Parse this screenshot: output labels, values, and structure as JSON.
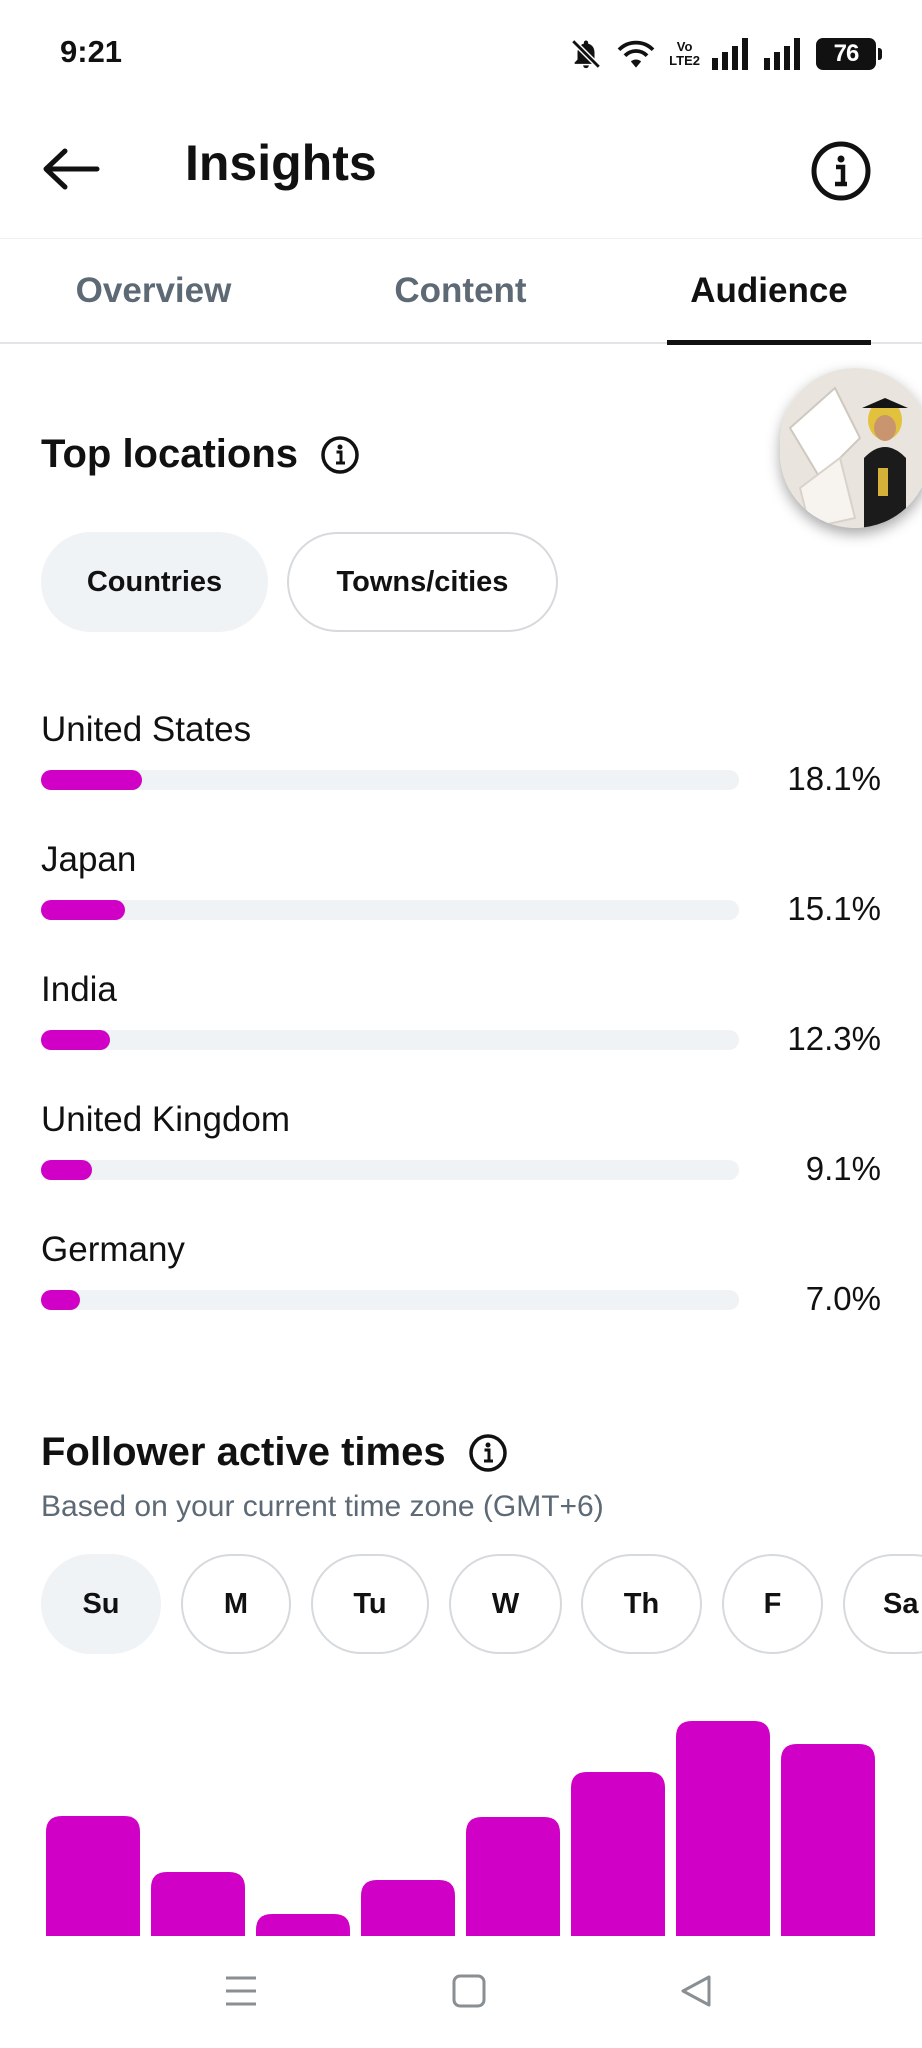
{
  "status_bar": {
    "time": "9:21",
    "battery": "76",
    "network_label_top": "Vo",
    "network_label_bottom": "LTE2"
  },
  "header": {
    "title": "Insights"
  },
  "tabs": [
    {
      "label": "Overview",
      "active": false
    },
    {
      "label": "Content",
      "active": false
    },
    {
      "label": "Audience",
      "active": true
    }
  ],
  "top_locations": {
    "title": "Top locations",
    "filters": [
      {
        "label": "Countries",
        "selected": true
      },
      {
        "label": "Towns/cities",
        "selected": false
      }
    ],
    "items": [
      {
        "name": "United States",
        "percent_label": "18.1%",
        "value": 18.1
      },
      {
        "name": "Japan",
        "percent_label": "15.1%",
        "value": 15.1
      },
      {
        "name": "India",
        "percent_label": "12.3%",
        "value": 12.3
      },
      {
        "name": "United Kingdom",
        "percent_label": "9.1%",
        "value": 9.1
      },
      {
        "name": "Germany",
        "percent_label": "7.0%",
        "value": 7.0
      }
    ]
  },
  "follower_active_times": {
    "title": "Follower active times",
    "subtitle": "Based on your current time zone (GMT+6)",
    "days": [
      {
        "label": "Su",
        "selected": true
      },
      {
        "label": "M",
        "selected": false
      },
      {
        "label": "Tu",
        "selected": false
      },
      {
        "label": "W",
        "selected": false
      },
      {
        "label": "Th",
        "selected": false
      },
      {
        "label": "F",
        "selected": false
      },
      {
        "label": "Sa",
        "selected": false
      }
    ]
  },
  "chart_data": {
    "type": "bar",
    "title": "",
    "xlabel": "",
    "ylabel": "",
    "values": [
      120,
      64,
      22,
      56,
      119,
      164,
      215,
      192
    ]
  },
  "colors": {
    "accent": "#d000c6",
    "track": "#eff3f5",
    "muted_text": "#5d6a75"
  },
  "nav_bar": {
    "icons": [
      "menu-icon",
      "home-square-icon",
      "back-triangle-icon"
    ]
  }
}
